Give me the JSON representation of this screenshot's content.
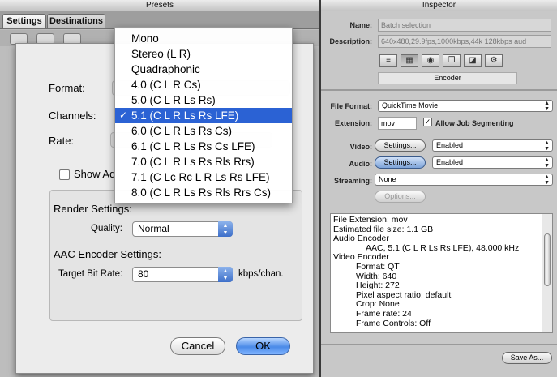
{
  "presets": {
    "title": "Presets",
    "tabs": [
      {
        "label": "Settings"
      },
      {
        "label": "Destinations"
      }
    ]
  },
  "sheet": {
    "format_label": "Format:",
    "channels_label": "Channels:",
    "rate_label": "Rate:",
    "show_advanced_label": "Show Ad",
    "render_settings_title": "Render Settings:",
    "quality_label": "Quality:",
    "quality_value": "Normal",
    "aac_title": "AAC Encoder Settings:",
    "target_bitrate_label": "Target Bit Rate:",
    "target_bitrate_value": "80",
    "bitrate_unit": "kbps/chan.",
    "cancel_label": "Cancel",
    "ok_label": "OK"
  },
  "channels_menu": {
    "selected_index": 4,
    "items": [
      {
        "label": "Mono"
      },
      {
        "label": "Stereo (L R)"
      },
      {
        "label": "Quadraphonic"
      },
      {
        "label": "4.0 (C L R Cs)"
      },
      {
        "label": "5.0 (C L R Ls Rs)"
      },
      {
        "label": "5.1 (C L R Ls Rs LFE)"
      },
      {
        "label": "6.0 (C L R Ls Rs Cs)"
      },
      {
        "label": "6.1 (C L R Ls Rs Cs LFE)"
      },
      {
        "label": "7.0 (C L R Ls Rs Rls Rrs)"
      },
      {
        "label": "7.1 (C Lc Rc L R Ls Rs LFE)"
      },
      {
        "label": "8.0 (C L R Ls Rs Rls Rrs Cs)"
      }
    ],
    "check_glyph": "✓"
  },
  "inspector": {
    "title": "Inspector",
    "name_label": "Name:",
    "name_value": "Batch selection",
    "description_label": "Description:",
    "description_value": "640x480,29.9fps,1000kbps,44k 128kbps aud",
    "tab_icons": [
      "summary-icon",
      "video-icon",
      "frame-icon",
      "filters-icon",
      "geometry-icon",
      "actions-icon"
    ],
    "encoder_label": "Encoder",
    "file_format_label": "File Format:",
    "file_format_value": "QuickTime Movie",
    "extension_label": "Extension:",
    "extension_value": "mov",
    "allow_segmenting_label": "Allow Job Segmenting",
    "video_label": "Video:",
    "audio_label": "Audio:",
    "settings_button": "Settings...",
    "enabled_value": "Enabled",
    "streaming_label": "Streaming:",
    "streaming_value": "None",
    "options_button": "Options...",
    "summary_lines": [
      "File Extension: mov",
      "Estimated file size: 1.1 GB",
      "Audio Encoder",
      "AAC, 5.1 (C L R Ls Rs LFE), 48.000 kHz",
      "Video Encoder",
      "Format: QT",
      "Width: 640",
      "Height: 272",
      "Pixel aspect ratio: default",
      "Crop: None",
      "Frame rate: 24",
      "Frame Controls: Off"
    ],
    "save_as_button": "Save As..."
  }
}
